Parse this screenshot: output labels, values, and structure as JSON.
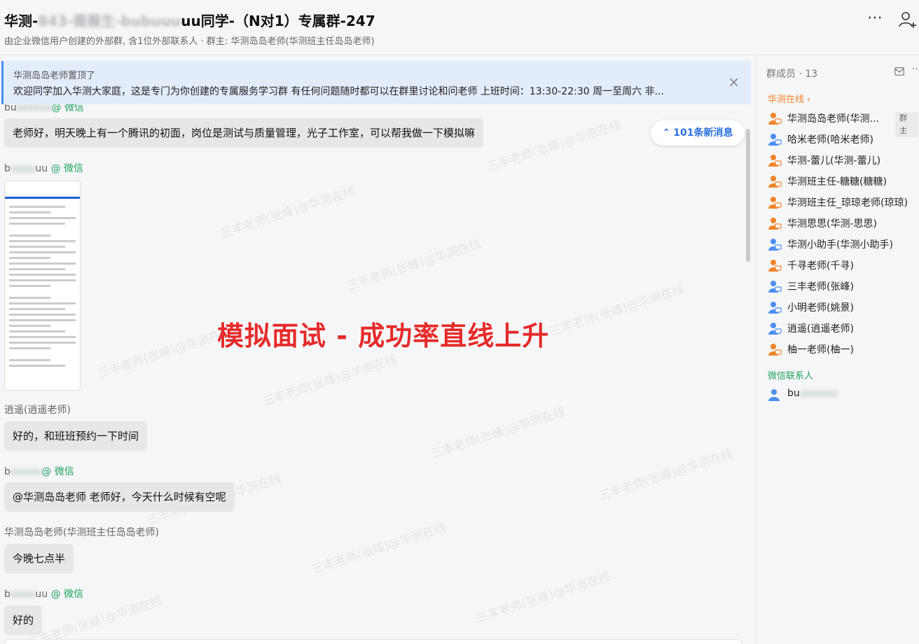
{
  "header": {
    "title_prefix": "华测-",
    "title_blurred": "843-薇薇生-bubuuu",
    "title_suffix": "uu同学-（N对1）专属群-247",
    "subtitle": "由企业微信用户创建的外部群, 含1位外部联系人 · 群主: 华测岛岛老师(华测班主任岛岛老师)",
    "more_icon": "more-horizontal-icon",
    "add_member_icon": "add-user-icon"
  },
  "pinned": {
    "title": "华测岛岛老师置顶了",
    "text": "欢迎同学加入华测大家庭，这是专门为你创建的专属服务学习群 有任何问题随时都可以在群里讨论和问老师  上班时间：13:30-22:30   周一至周六 非...",
    "close": "×"
  },
  "new_messages": {
    "label": "101条新消息",
    "arrow": "⌃"
  },
  "messages": [
    {
      "sender_prefix": "bu",
      "sender_blurred": "xxxxxx",
      "sender_tag": "@ 微信",
      "text": "老师好，明天晚上有一个腾讯的初面，岗位是测试与质量管理，光子工作室，可以帮我做一下模拟嘛"
    },
    {
      "sender_prefix": "b",
      "sender_blurred": "uuuu",
      "sender_suffix": "uu",
      "sender_tag": "@ 微信",
      "type": "image"
    },
    {
      "sender": "逍遥(逍遥老师)",
      "text": "好的，和班班预约一下时间"
    },
    {
      "sender_prefix": "b",
      "sender_blurred": "uuuuu",
      "sender_tag": "@ 微信",
      "text": "@华测岛岛老师 老师好，今天什么时候有空呢"
    },
    {
      "sender": "华测岛岛老师(华测班主任岛岛老师)",
      "text": "今晚七点半"
    },
    {
      "sender_prefix": "b",
      "sender_blurred": "uuuu",
      "sender_suffix": "uu",
      "sender_tag": "@ 微信",
      "text": "好的"
    }
  ],
  "overlay": "模拟面试 - 成功率直线上升",
  "watermark": "三丰老师(张峰)@华测在线",
  "members_panel": {
    "title": "群成员 · 13",
    "group_online_label": "华测在线 ›",
    "group_wechat_label": "微信联系人",
    "owner_badge": "群主",
    "online_members": [
      {
        "name": "华测岛岛老师(华测...",
        "color": "#f0832b"
      },
      {
        "name": "哈米老师(哈米老师)",
        "color": "#4a8ff0"
      },
      {
        "name": "华测-蕾儿(华测-蕾儿)",
        "color": "#f0832b"
      },
      {
        "name": "华测班主任-糖糖(糖糖)",
        "color": "#f0832b"
      },
      {
        "name": "华测班主任_琼琼老师(琼琼)",
        "color": "#f0832b"
      },
      {
        "name": "华测思思(华测-思思)",
        "color": "#f0832b"
      },
      {
        "name": "华测小助手(华测小助手)",
        "color": "#4a8ff0"
      },
      {
        "name": "千寻老师(千寻)",
        "color": "#f0832b"
      },
      {
        "name": "三丰老师(张峰)",
        "color": "#4a8ff0"
      },
      {
        "name": "小明老师(姚景)",
        "color": "#4a8ff0"
      },
      {
        "name": "逍遥(逍遥老师)",
        "color": "#4a8ff0"
      },
      {
        "name": "柚一老师(柚一)",
        "color": "#f0832b"
      }
    ],
    "wechat_member": {
      "name_prefix": "bu",
      "name_blurred": "uuuuuu",
      "color": "#4a8ff0"
    }
  }
}
